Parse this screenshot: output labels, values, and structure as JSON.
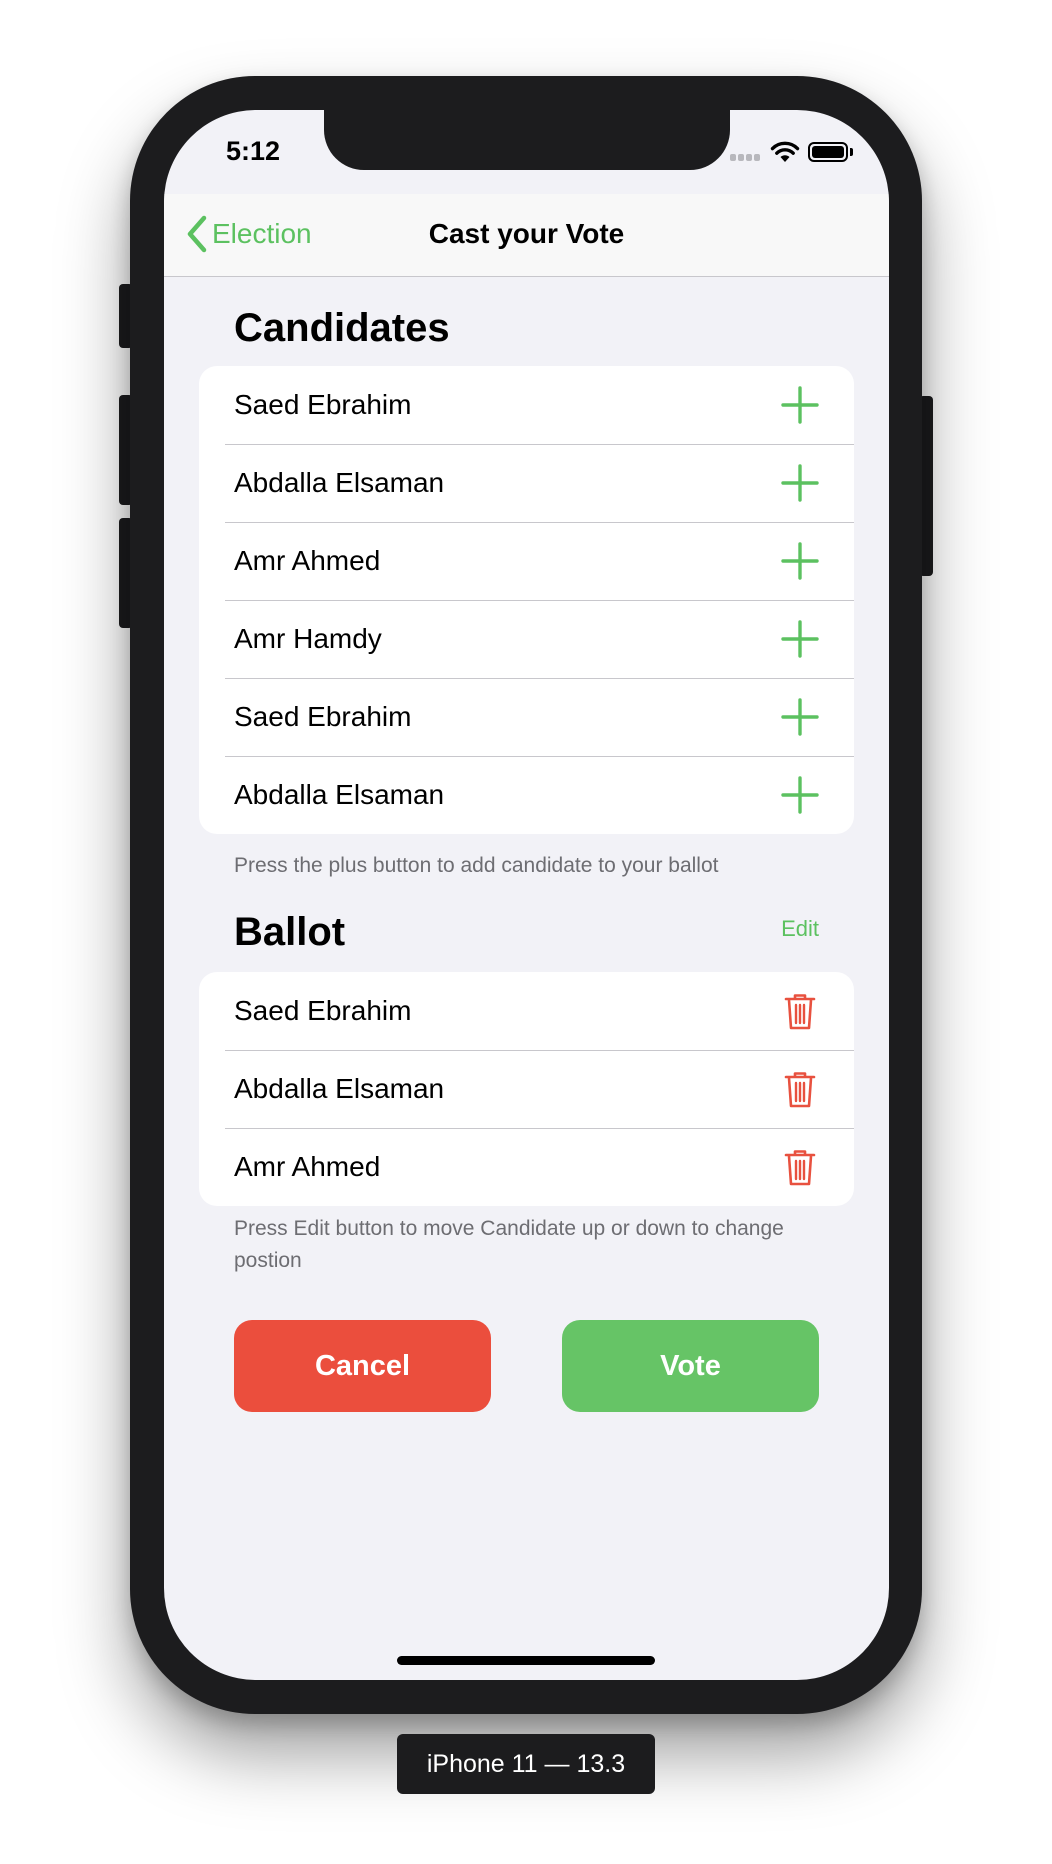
{
  "status_bar": {
    "time": "5:12"
  },
  "nav": {
    "back_label": "Election",
    "title": "Cast your Vote"
  },
  "candidates": {
    "header": "Candidates",
    "items": [
      {
        "name": "Saed Ebrahim"
      },
      {
        "name": "Abdalla Elsaman"
      },
      {
        "name": "Amr Ahmed"
      },
      {
        "name": "Amr Hamdy"
      },
      {
        "name": "Saed Ebrahim"
      },
      {
        "name": "Abdalla Elsaman"
      }
    ],
    "footer": "Press the plus button to add candidate to your ballot"
  },
  "ballot": {
    "header": "Ballot",
    "edit_label": "Edit",
    "items": [
      {
        "name": "Saed Ebrahim"
      },
      {
        "name": "Abdalla Elsaman"
      },
      {
        "name": "Amr Ahmed"
      }
    ],
    "footer": "Press Edit button to move Candidate up or down to change postion"
  },
  "actions": {
    "cancel_label": "Cancel",
    "vote_label": "Vote"
  },
  "device_label": "iPhone 11 — 13.3",
  "colors": {
    "accent_green": "#5cc160",
    "vote_green": "#66c466",
    "cancel_red": "#eb4e3d",
    "trash_red": "#e8513f",
    "background": "#f2f2f7"
  },
  "icons": {
    "add": "plus-icon",
    "delete": "trash-icon",
    "back": "chevron-left-icon"
  }
}
